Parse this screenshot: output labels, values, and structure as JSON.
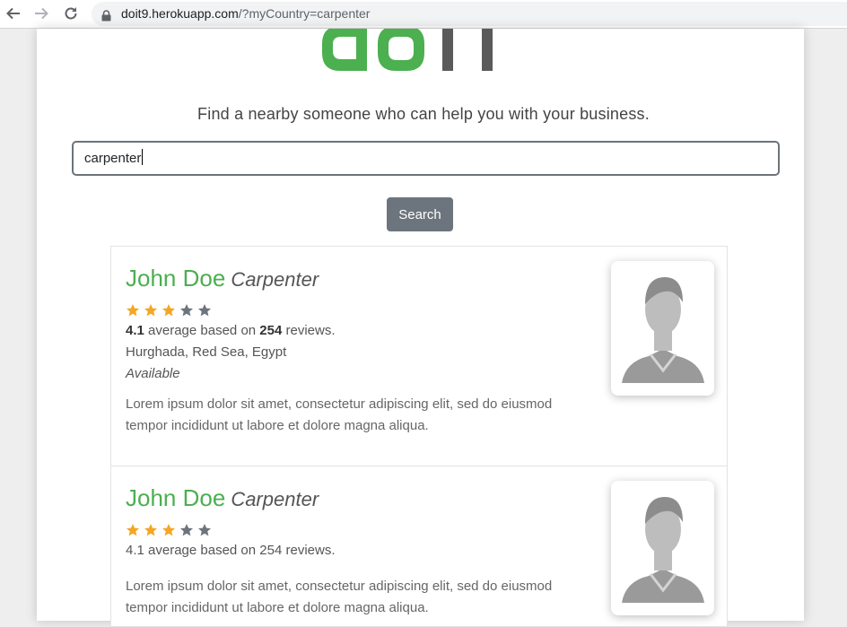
{
  "browser": {
    "url_host": "doit9.herokuapp.com",
    "url_path": "/?myCountry=carpenter"
  },
  "header": {
    "logo_text": "doit",
    "tagline": "Find a nearby someone who can help you with your business."
  },
  "search": {
    "value": "carpenter",
    "button_label": "Search"
  },
  "colors": {
    "brand_green": "#4caf50",
    "logo_gray": "#555555",
    "star_filled": "#f5a623",
    "star_empty": "#6c757d",
    "button_gray": "#6c757d"
  },
  "results": [
    {
      "name": "John Doe",
      "role": "Carpenter",
      "rating_stars": 3,
      "max_stars": 5,
      "rating_value": "4.1",
      "text_average": " average based on ",
      "review_count": "254",
      "text_reviews": " reviews.",
      "location": "Hurghada, Red Sea, Egypt",
      "availability": "Available",
      "description": "Lorem ipsum dolor sit amet, consectetur adipiscing elit, sed do eiusmod tempor incididunt ut labore et dolore magna aliqua."
    },
    {
      "name": "John Doe",
      "role": "Carpenter",
      "rating_stars": 3,
      "max_stars": 5,
      "rating_summary": "4.1 average based on 254 reviews.",
      "description": "Lorem ipsum dolor sit amet, consectetur adipiscing elit, sed do eiusmod tempor incididunt ut labore et dolore magna aliqua."
    }
  ]
}
